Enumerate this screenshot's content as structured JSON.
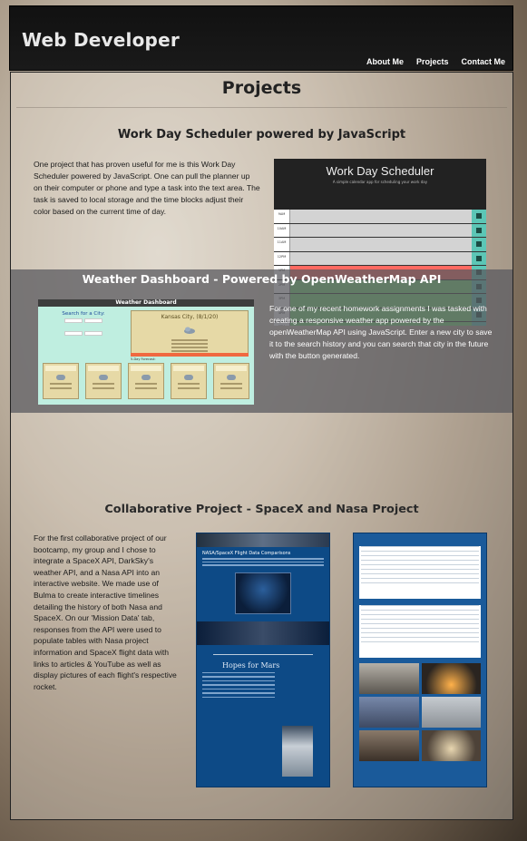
{
  "header": {
    "brand": "Web Developer",
    "nav": [
      "About Me",
      "Projects",
      "Contact Me"
    ]
  },
  "main": {
    "title": "Projects",
    "project1": {
      "title": "Work Day Scheduler powered by JavaScript",
      "description": "One project that has proven useful for me is this Work Day Scheduler powered by JavaScript. One can pull the planner up on their computer or phone and type a task into the text area. The task is saved to local storage and the time blocks adjust their color based on the current time of day.",
      "screenshot": {
        "title": "Work Day Scheduler",
        "subtitle": "A simple calendar app for scheduling your work day",
        "hours": [
          {
            "hour": "9AM",
            "task": "",
            "state": "past"
          },
          {
            "hour": "10AM",
            "task": "",
            "state": "past"
          },
          {
            "hour": "11AM",
            "task": "",
            "state": "past"
          },
          {
            "hour": "12PM",
            "task": "",
            "state": "past"
          },
          {
            "hour": "1PM",
            "task": "",
            "state": "present"
          },
          {
            "hour": "2PM",
            "task": "",
            "state": "future"
          },
          {
            "hour": "3PM",
            "task": "",
            "state": "future"
          },
          {
            "hour": "4PM",
            "task": "",
            "state": "future"
          },
          {
            "hour": "5PM",
            "task": "",
            "state": "future"
          }
        ]
      }
    },
    "project2": {
      "title": "Weather Dashboard - Powered by OpenWeatherMap API",
      "description": "For one of my recent homework assignments I was tasked with creating a responsive weather app powered by the openWeatherMap API using JavaScript. Enter a new city to save it to the search history and you can search that city in the future with the button generated.",
      "screenshot": {
        "header": "Weather Dashboard",
        "search_label": "Search for a City:",
        "city": "Kansas City, (8/1/20)",
        "forecast_label": "5-Day Forecast:",
        "forecast_count": 5
      }
    },
    "project3": {
      "title": "Collaborative Project - SpaceX and Nasa Project",
      "description": "For the first collaborative project of our bootcamp, my group and I chose to integrate a SpaceX API, DarkSky's weather API, and a Nasa API into an interactive website. We made use of Bulma to create interactive timelines detailing the history of both Nasa and SpaceX. On our 'Mission Data' tab, responses from the API were used to populate tables with Nasa project information and SpaceX flight data with links to articles & YouTube as well as display pictures of each flight's respective rocket.",
      "screenshot_a": {
        "heading": "NASA/SpaceX Flight Data Comparisons",
        "subheading": "Hopes for Mars"
      }
    }
  },
  "colors": {
    "past": "#d3d3d3",
    "present": "#ff6961",
    "future": "#77dd77",
    "save": "#5cc6b6"
  }
}
